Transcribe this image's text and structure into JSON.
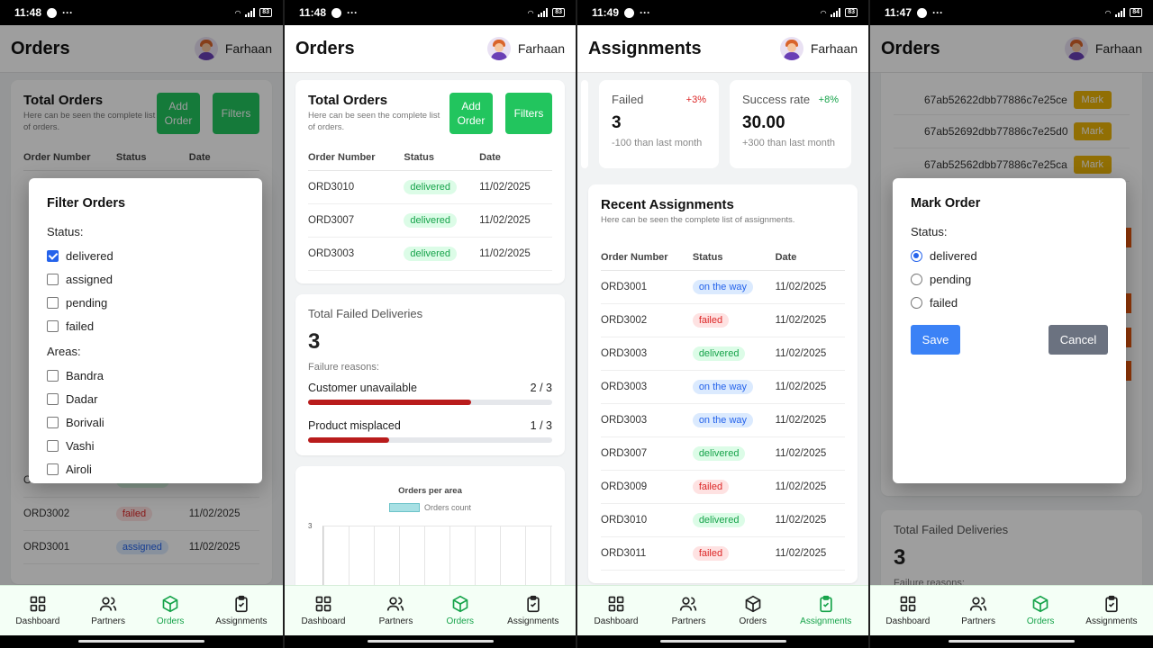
{
  "status_bars": [
    {
      "time": "11:48",
      "battery": "83"
    },
    {
      "time": "11:48",
      "battery": "83"
    },
    {
      "time": "11:49",
      "battery": "83"
    },
    {
      "time": "11:47",
      "battery": "84"
    }
  ],
  "user": {
    "name": "Farhaan"
  },
  "nav": {
    "dashboard": "Dashboard",
    "partners": "Partners",
    "orders": "Orders",
    "assignments": "Assignments"
  },
  "screen1": {
    "title": "Orders",
    "card_title": "Total Orders",
    "card_sub": "Here can be seen the complete list of orders.",
    "add_order": "Add Order",
    "filters": "Filters",
    "headers": [
      "Order Number",
      "Status",
      "Date"
    ],
    "rows": [
      {
        "order": "ORD3003",
        "status": "delivered",
        "date": "11/02/2025"
      },
      {
        "order": "ORD3002",
        "status": "failed",
        "date": "11/02/2025"
      },
      {
        "order": "ORD3001",
        "status": "assigned",
        "date": "11/02/2025"
      }
    ],
    "filter_dialog": {
      "title": "Filter Orders",
      "status_label": "Status:",
      "status_options": [
        {
          "label": "delivered",
          "checked": true
        },
        {
          "label": "assigned",
          "checked": false
        },
        {
          "label": "pending",
          "checked": false
        },
        {
          "label": "failed",
          "checked": false
        }
      ],
      "areas_label": "Areas:",
      "area_options": [
        "Bandra",
        "Dadar",
        "Borivali",
        "Vashi",
        "Airoli"
      ]
    }
  },
  "screen2": {
    "title": "Orders",
    "card_title": "Total Orders",
    "card_sub": "Here can be seen the complete list of orders.",
    "add_order": "Add Order",
    "filters": "Filters",
    "headers": [
      "Order Number",
      "Status",
      "Date"
    ],
    "rows": [
      {
        "order": "ORD3010",
        "status": "delivered",
        "date": "11/02/2025"
      },
      {
        "order": "ORD3007",
        "status": "delivered",
        "date": "11/02/2025"
      },
      {
        "order": "ORD3003",
        "status": "delivered",
        "date": "11/02/2025"
      }
    ],
    "failed": {
      "title": "Total Failed Deliveries",
      "count": "3",
      "reasons_label": "Failure reasons:",
      "reasons": [
        {
          "label": "Customer unavailable",
          "ratio": "2 / 3",
          "fraction": 0.667
        },
        {
          "label": "Product misplaced",
          "ratio": "1 / 3",
          "fraction": 0.333
        }
      ]
    },
    "chart_data": {
      "type": "bar",
      "title": "Orders per area",
      "legend": [
        "Orders count"
      ],
      "y_tick_visible": "3"
    }
  },
  "screen3": {
    "title": "Assignments",
    "stats": [
      {
        "name": "Failed",
        "pct": "+3%",
        "value": "3",
        "cmp": "-100 than last month",
        "pct_color": "#dc2626"
      },
      {
        "name": "Success rate",
        "pct": "+8%",
        "value": "30.00",
        "cmp": "+300 than last month",
        "pct_color": "#16a34a"
      }
    ],
    "card_title": "Recent Assignments",
    "card_sub": "Here can be seen the complete list of assignments.",
    "headers": [
      "Order Number",
      "Status",
      "Date"
    ],
    "rows": [
      {
        "order": "ORD3001",
        "status": "on the way",
        "date": "11/02/2025"
      },
      {
        "order": "ORD3002",
        "status": "failed",
        "date": "11/02/2025"
      },
      {
        "order": "ORD3003",
        "status": "delivered",
        "date": "11/02/2025"
      },
      {
        "order": "ORD3003",
        "status": "on the way",
        "date": "11/02/2025"
      },
      {
        "order": "ORD3003",
        "status": "on the way",
        "date": "11/02/2025"
      },
      {
        "order": "ORD3007",
        "status": "delivered",
        "date": "11/02/2025"
      },
      {
        "order": "ORD3009",
        "status": "failed",
        "date": "11/02/2025"
      },
      {
        "order": "ORD3010",
        "status": "delivered",
        "date": "11/02/2025"
      },
      {
        "order": "ORD3011",
        "status": "failed",
        "date": "11/02/2025"
      }
    ]
  },
  "screen4": {
    "title": "Orders",
    "ids": [
      "67ab52622dbb77886c7e25ce",
      "67ab52692dbb77886c7e25d0",
      "67ab52562dbb77886c7e25ca"
    ],
    "mark_label": "Mark",
    "failed_title": "Total Failed Deliveries",
    "failed_count": "3",
    "failed_reasons_label": "Failure reasons:",
    "dialog": {
      "title": "Mark Order",
      "status_label": "Status:",
      "options": [
        {
          "label": "delivered",
          "selected": true
        },
        {
          "label": "pending",
          "selected": false
        },
        {
          "label": "failed",
          "selected": false
        }
      ],
      "save": "Save",
      "cancel": "Cancel"
    }
  }
}
